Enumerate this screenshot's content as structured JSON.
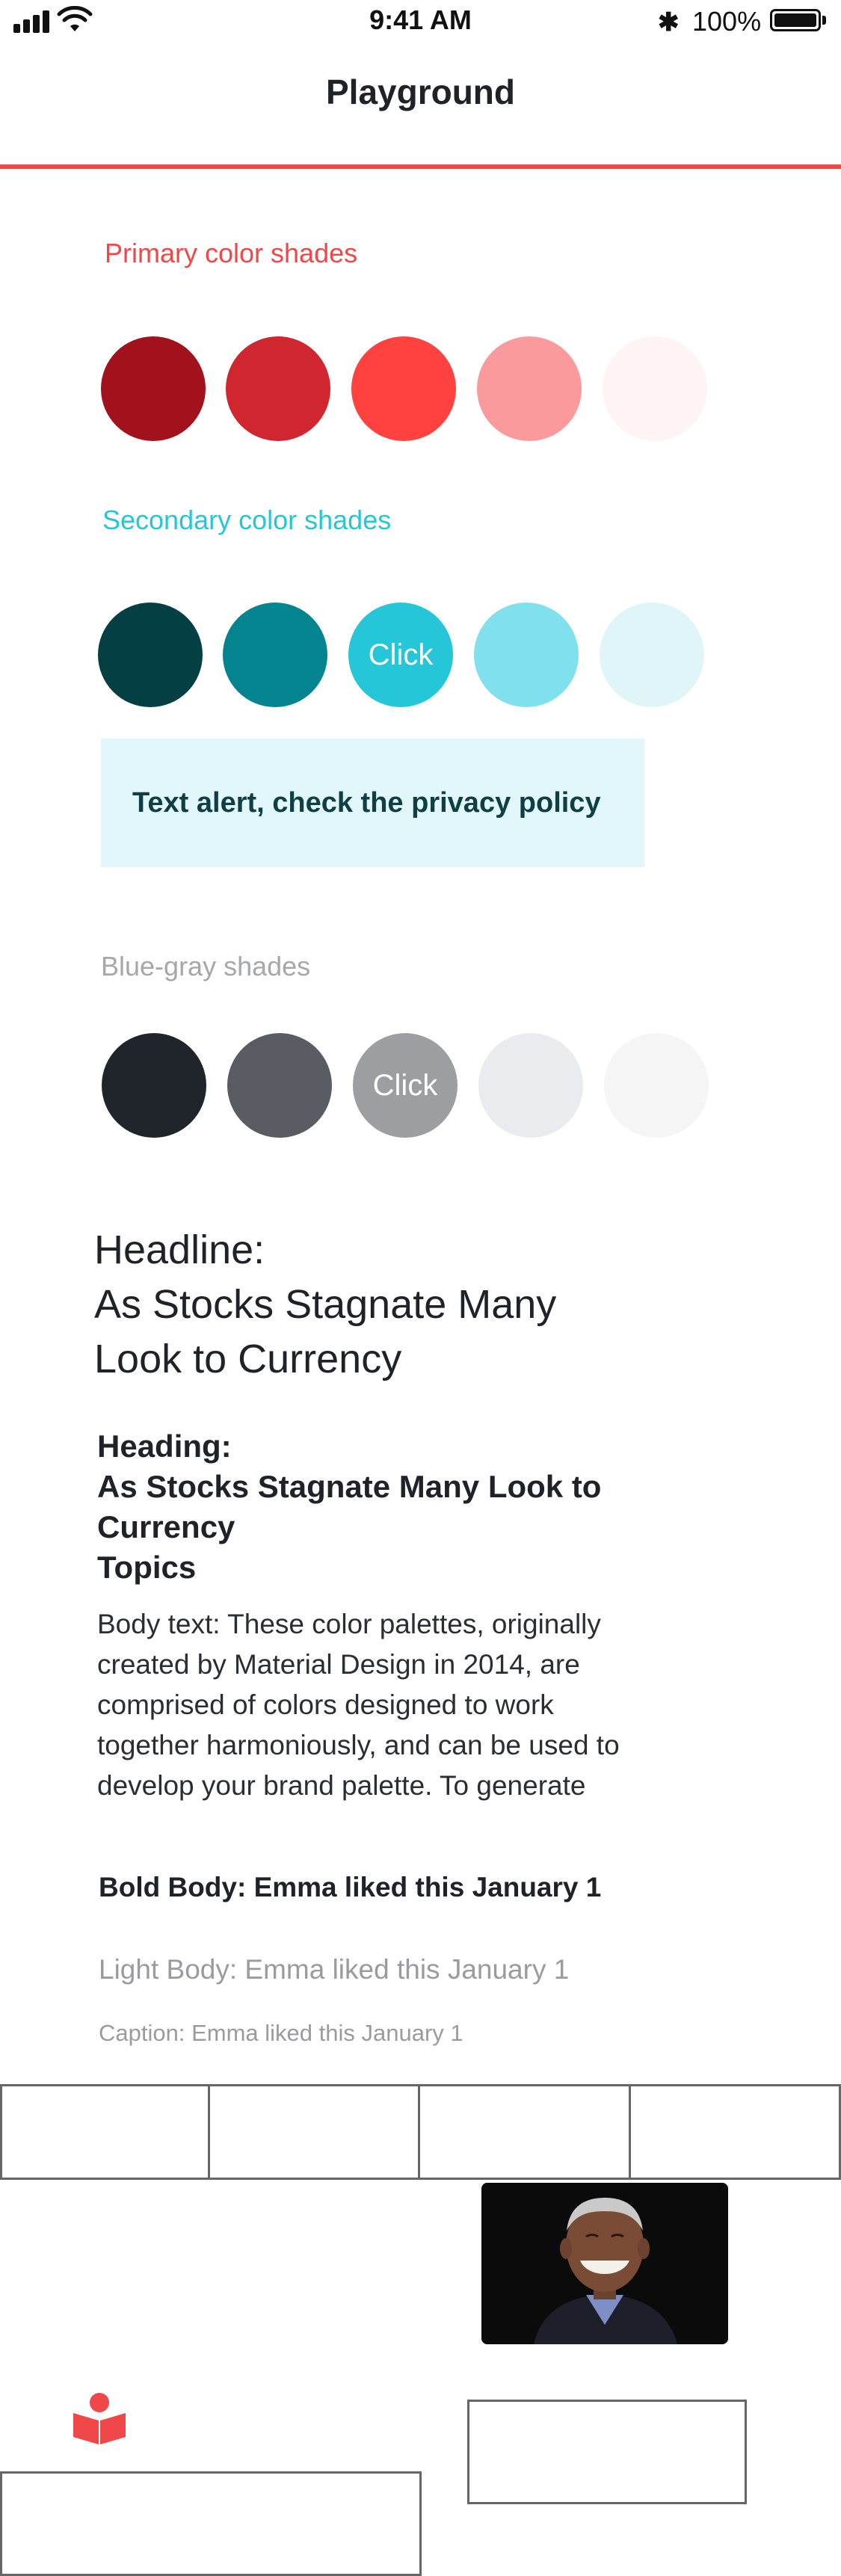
{
  "status_bar": {
    "time": "9:41 AM",
    "battery": "100%",
    "bluetooth_symbol": "✱"
  },
  "nav": {
    "title": "Playground"
  },
  "primary": {
    "label": "Primary color shades",
    "label_color": "#f04848",
    "swatches": [
      {
        "color": "#a1121d",
        "text": ""
      },
      {
        "color": "#d0262f",
        "text": ""
      },
      {
        "color": "#ff4240",
        "text": ""
      },
      {
        "color": "#fb9a9c",
        "text": ""
      },
      {
        "color": "#fff4f4",
        "text": ""
      }
    ]
  },
  "secondary": {
    "label": "Secondary color shades",
    "label_color": "#27c6d6",
    "swatches": [
      {
        "color": "#043f44",
        "text": ""
      },
      {
        "color": "#03848f",
        "text": ""
      },
      {
        "color": "#24c6d8",
        "text": "Click"
      },
      {
        "color": "#80e0ed",
        "text": ""
      },
      {
        "color": "#dff5f8",
        "text": ""
      }
    ]
  },
  "alert": {
    "text": "Text alert, check the privacy policy"
  },
  "bluegray": {
    "label": "Blue-gray shades",
    "label_color": "#a6a7ab",
    "swatches": [
      {
        "color": "#20242b",
        "text": ""
      },
      {
        "color": "#595c63",
        "text": ""
      },
      {
        "color": "#9d9ea2",
        "text": "Click"
      },
      {
        "color": "#eaebee",
        "text": ""
      },
      {
        "color": "#f5f5f6",
        "text": ""
      }
    ]
  },
  "typography": {
    "headline_1": "Headline:",
    "headline_2": "As Stocks Stagnate Many",
    "headline_3": "Look to Currency",
    "heading_1": "Heading:",
    "heading_2": "As Stocks Stagnate Many Look to",
    "heading_3": "Currency",
    "heading_4": "Topics",
    "body_1": "Body text: These color palettes, originally",
    "body_2": "created by Material Design in 2014, are",
    "body_3": "comprised of colors designed to work",
    "body_4": "together harmoniously, and can be used to",
    "body_5": "develop your brand palette. To generate",
    "bold_body": "Bold Body: Emma liked this January 1",
    "light_body": "Light Body: Emma liked this January 1",
    "caption": "Caption: Emma liked this January 1"
  },
  "icons": {
    "logo": "book-reader-icon",
    "logo_color": "#f04848"
  }
}
